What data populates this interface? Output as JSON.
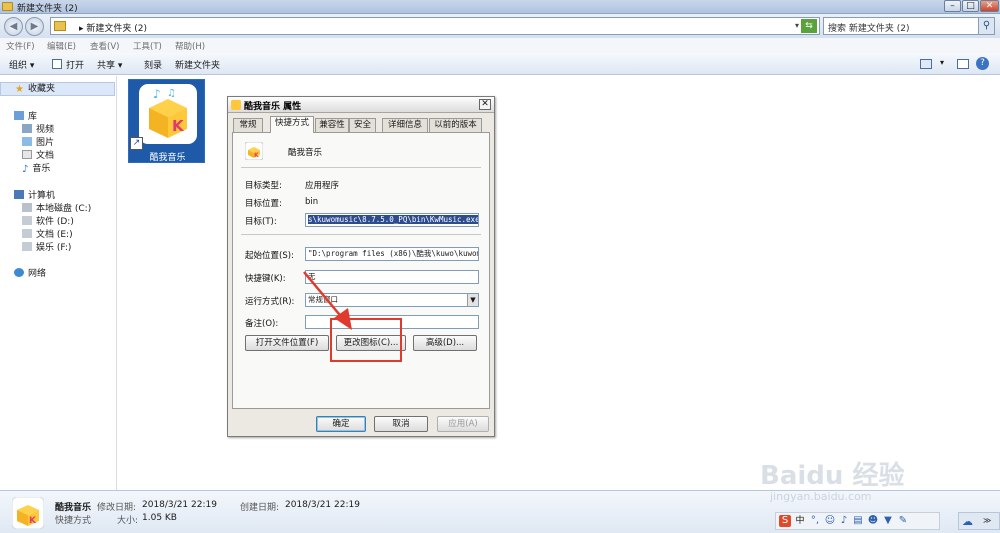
{
  "window": {
    "title": "新建文件夹 (2)"
  },
  "address": {
    "path": "▸ 新建文件夹 (2)",
    "search": "搜索 新建文件夹 (2)"
  },
  "menu": [
    "文件(F)",
    "编辑(E)",
    "查看(V)",
    "工具(T)",
    "帮助(H)"
  ],
  "toolbar": {
    "organize": "组织 ▾",
    "open": "打开",
    "share": "共享 ▾",
    "burn": "刻录",
    "new_folder": "新建文件夹"
  },
  "sidebar": {
    "favorites": "收藏夹",
    "library": "库",
    "library_items": [
      "视频",
      "图片",
      "文档",
      "音乐"
    ],
    "computer": "计算机",
    "drives": [
      "本地磁盘 (C:)",
      "软件 (D:)",
      "文档 (E:)",
      "娱乐 (F:)"
    ],
    "network": "网络"
  },
  "file": {
    "name": "酷我音乐"
  },
  "dialog": {
    "title": "酷我音乐 属性",
    "tabs": [
      "常规",
      "快捷方式",
      "兼容性",
      "安全",
      "详细信息",
      "以前的版本"
    ],
    "app_name": "酷我音乐",
    "target_type_label": "目标类型:",
    "target_type": "应用程序",
    "target_location_label": "目标位置:",
    "target_location": "bin",
    "target_label": "目标(T):",
    "target": "s\\kuwomusic\\8.7.5.0_PQ\\bin\\KwMusic.exe\"",
    "start_in_label": "起始位置(S):",
    "start_in": "\"D:\\program files (x86)\\酷我\\kuwo\\kuwom",
    "shortcut_key_label": "快捷键(K):",
    "shortcut_key": "无",
    "run_label": "运行方式(R):",
    "run": "常规窗口",
    "comment_label": "备注(O):",
    "comment": "",
    "btn_open_location": "打开文件位置(F)",
    "btn_change_icon": "更改图标(C)...",
    "btn_advanced": "高级(D)...",
    "btn_ok": "确定",
    "btn_cancel": "取消",
    "btn_apply": "应用(A)"
  },
  "status": {
    "name": "酷我音乐",
    "modified_label": "修改日期:",
    "modified": "2018/3/21 22:19",
    "created_label": "创建日期:",
    "created": "2018/3/21 22:19",
    "type": "快捷方式",
    "size_label": "大小:",
    "size": "1.05 KB"
  },
  "watermark": {
    "main": "Baidu 经验",
    "sub": "jingyan.baidu.com"
  },
  "colors": {
    "highlight": "#2d4c8f",
    "annotation": "#e03a2c"
  }
}
